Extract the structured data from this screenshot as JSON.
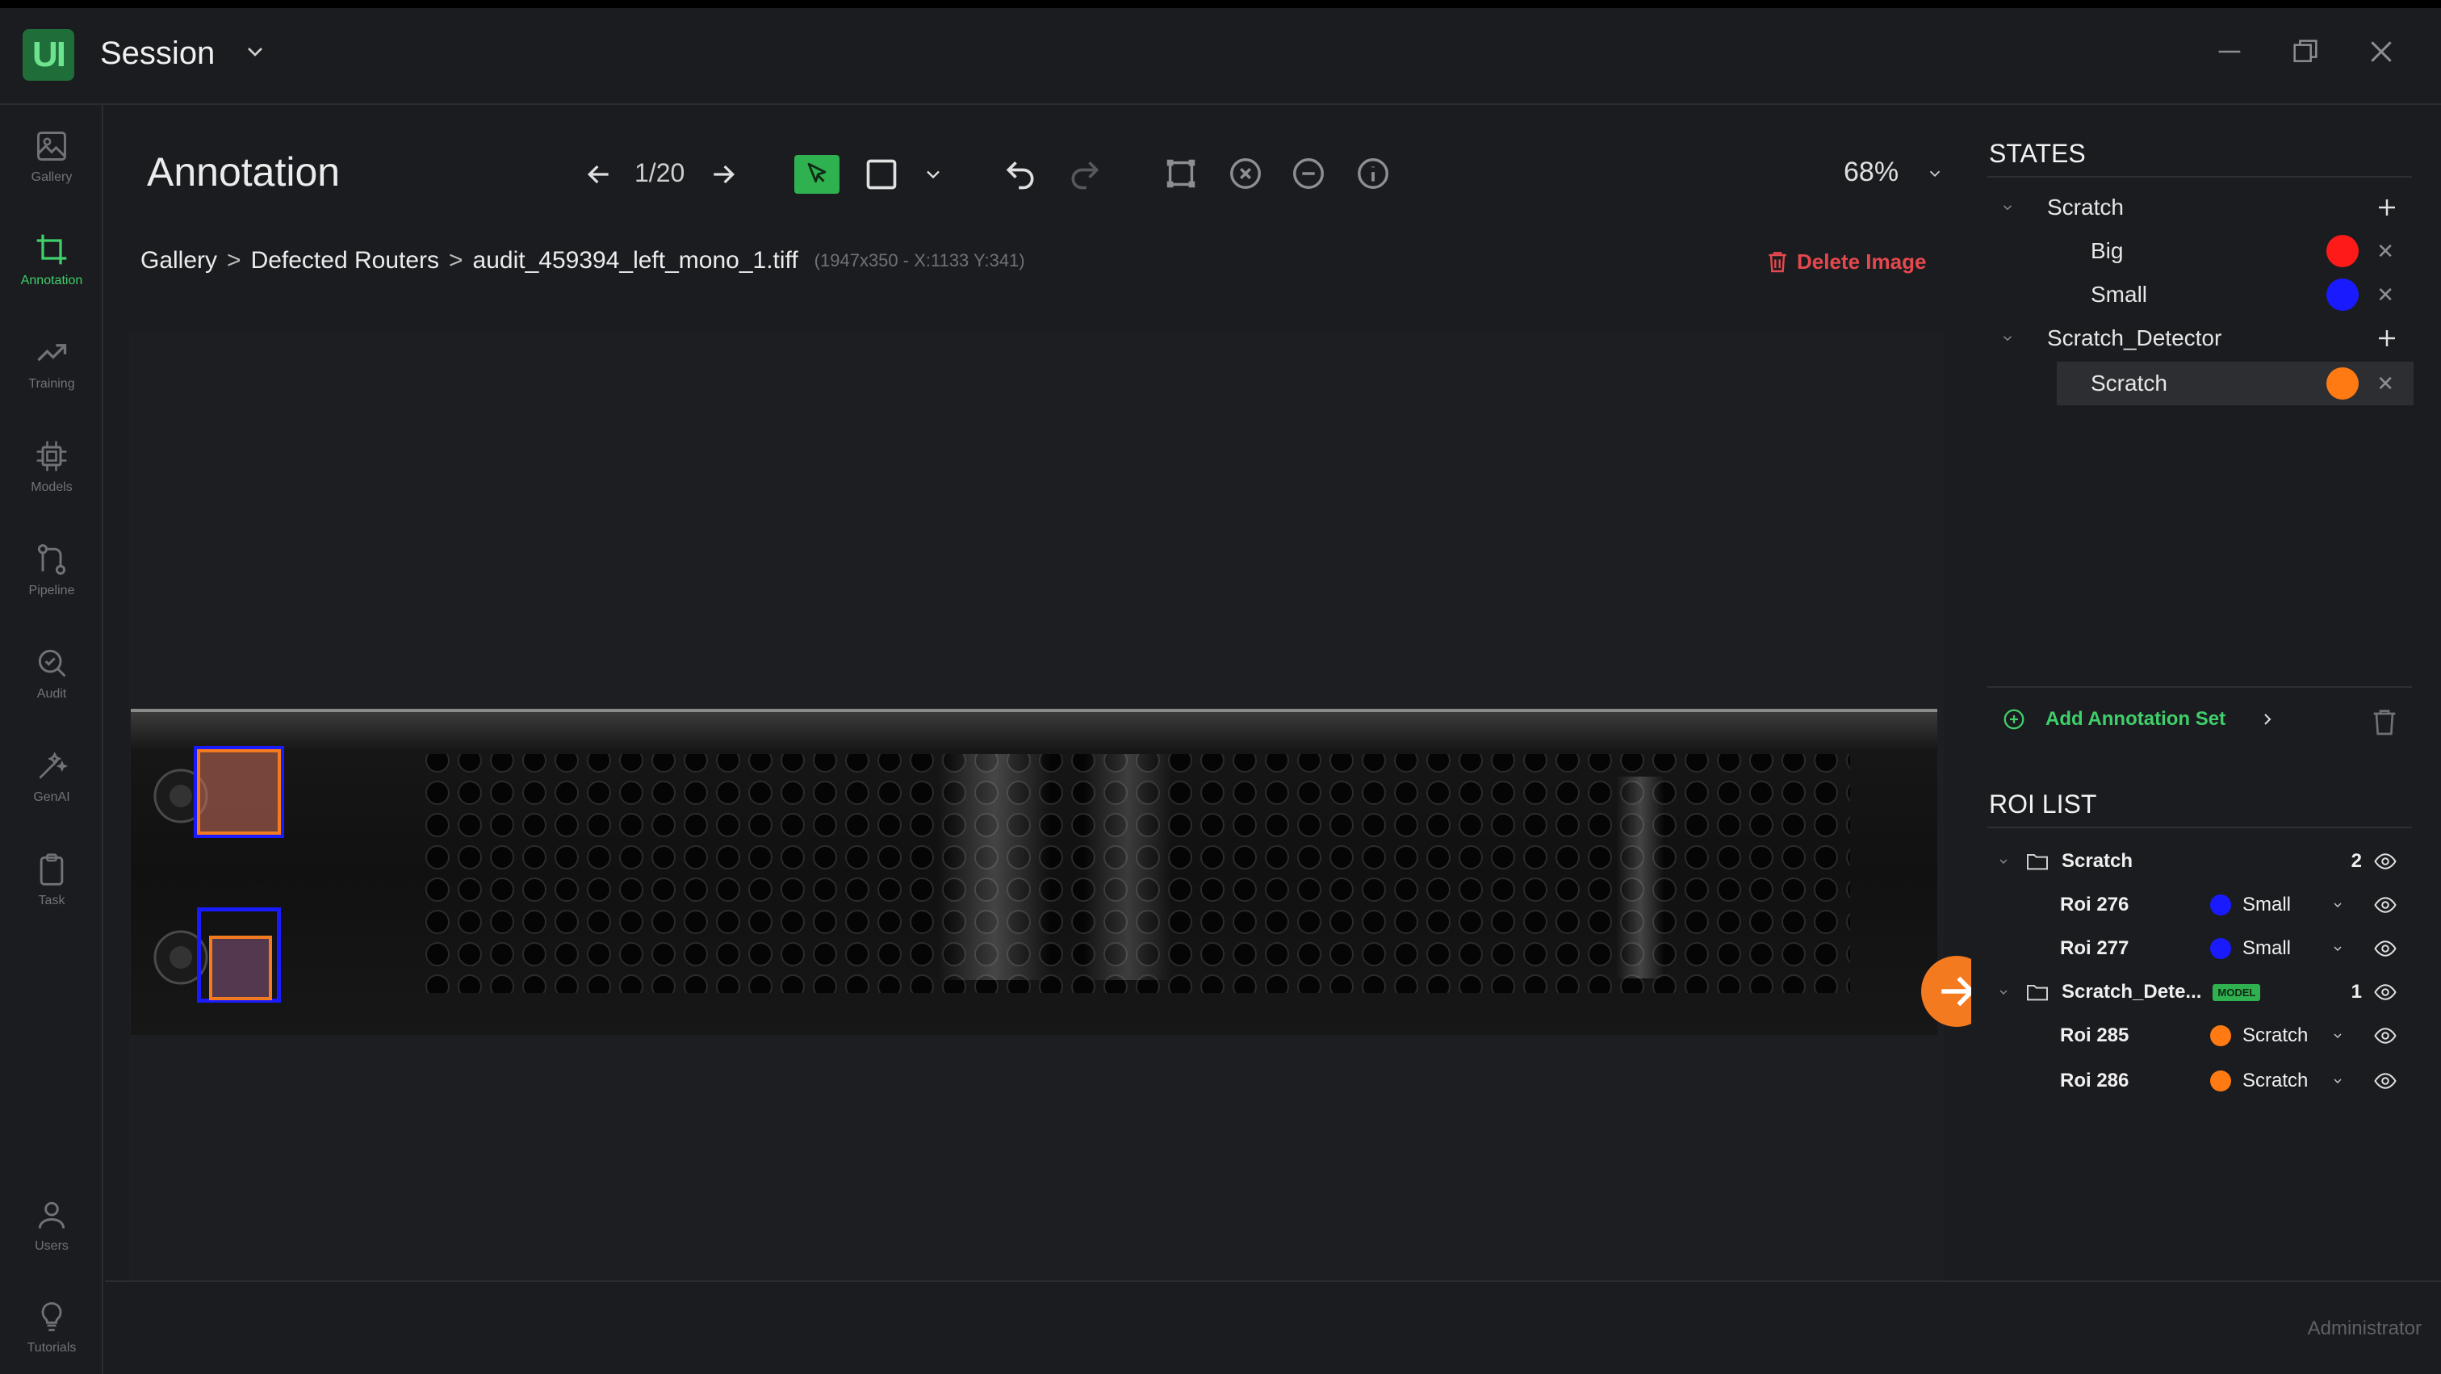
{
  "app": {
    "logo_text": "UI",
    "session_title": "Session"
  },
  "sidenav": {
    "items": [
      {
        "label": "Gallery",
        "icon": "gallery-icon",
        "active": false
      },
      {
        "label": "Annotation",
        "icon": "crop-icon",
        "active": true
      },
      {
        "label": "Training",
        "icon": "trending-icon",
        "active": false
      },
      {
        "label": "Models",
        "icon": "chip-icon",
        "active": false
      },
      {
        "label": "Pipeline",
        "icon": "pipeline-icon",
        "active": false
      },
      {
        "label": "Audit",
        "icon": "audit-search-icon",
        "active": false
      },
      {
        "label": "GenAI",
        "icon": "wand-icon",
        "active": false
      },
      {
        "label": "Task",
        "icon": "clipboard-icon",
        "active": false
      }
    ],
    "bottom_items": [
      {
        "label": "Users",
        "icon": "user-icon"
      },
      {
        "label": "Tutorials",
        "icon": "lightbulb-icon"
      }
    ]
  },
  "header": {
    "title": "Annotation",
    "pager": "1/20",
    "zoom": "68%"
  },
  "breadcrumb": {
    "items": [
      "Gallery",
      "Defected Routers",
      "audit_459394_left_mono_1.tiff"
    ],
    "separator": ">",
    "meta": "(1947x350 - X:1133 Y:341)"
  },
  "delete_image_label": "Delete Image",
  "states": {
    "title": "STATES",
    "groups": [
      {
        "name": "Scratch",
        "children": [
          {
            "name": "Big",
            "color": "#ff1a1a"
          },
          {
            "name": "Small",
            "color": "#1a1aff"
          }
        ]
      },
      {
        "name": "Scratch_Detector",
        "children": [
          {
            "name": "Scratch",
            "color": "#ff7a12",
            "selected": true
          }
        ]
      }
    ],
    "add_set_label": "Add Annotation Set"
  },
  "roi_list": {
    "title": "ROI LIST",
    "groups": [
      {
        "name": "Scratch",
        "count": "2",
        "badge": "",
        "rois": [
          {
            "name": "Roi 276",
            "state": "Small",
            "color": "#1a1aff"
          },
          {
            "name": "Roi 277",
            "state": "Small",
            "color": "#1a1aff"
          }
        ]
      },
      {
        "name": "Scratch_Dete...",
        "count": "1",
        "badge": "MODEL",
        "rois": [
          {
            "name": "Roi 285",
            "state": "Scratch",
            "color": "#ff7a12"
          },
          {
            "name": "Roi 286",
            "state": "Scratch",
            "color": "#ff7a12"
          }
        ]
      }
    ]
  },
  "footer": {
    "user_role": "Administrator"
  },
  "colors": {
    "accent": "#3fcf6b",
    "danger": "#e5484d",
    "orange": "#f47a1f"
  }
}
